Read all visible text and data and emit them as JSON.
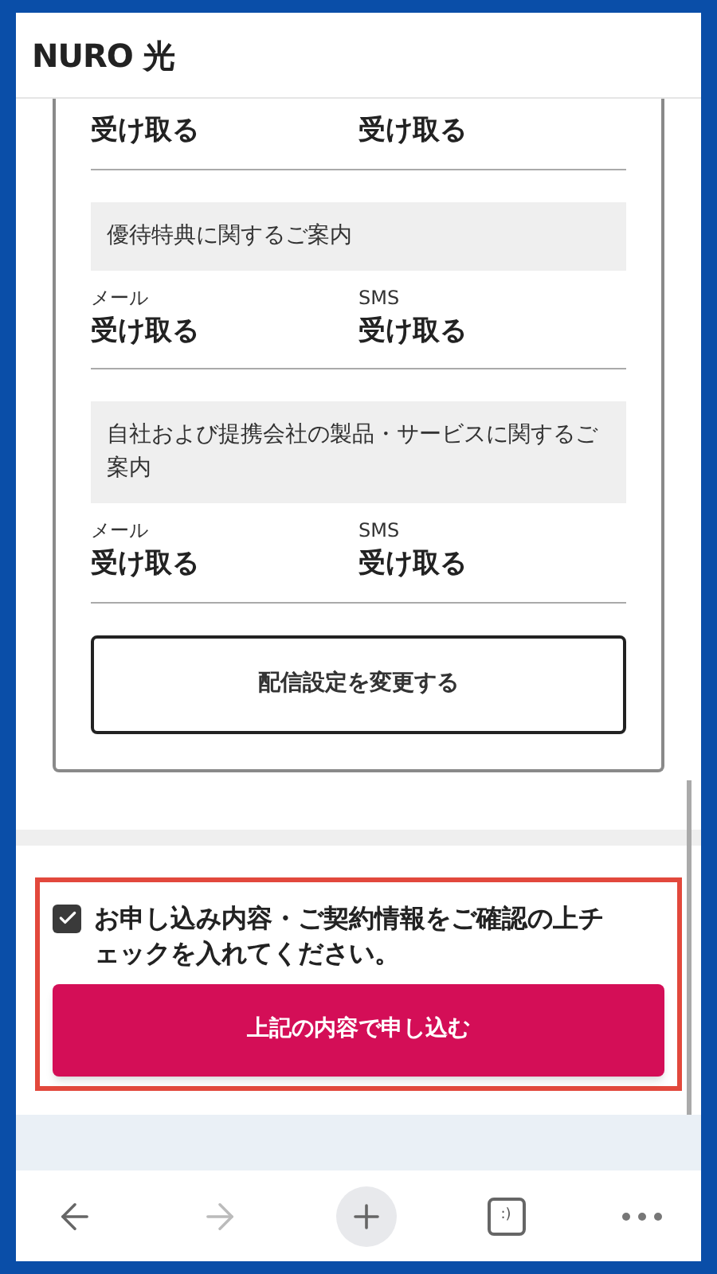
{
  "header": {
    "logo": "NURO 光"
  },
  "sections": [
    {
      "fields": [
        {
          "value": "受け取る"
        },
        {
          "value": "受け取る"
        }
      ]
    },
    {
      "title": "優待特典に関するご案内",
      "fields": [
        {
          "label": "メール",
          "value": "受け取る"
        },
        {
          "label": "SMS",
          "value": "受け取る"
        }
      ]
    },
    {
      "title": "自社および提携会社の製品・サービスに関するご案内",
      "fields": [
        {
          "label": "メール",
          "value": "受け取る"
        },
        {
          "label": "SMS",
          "value": "受け取る"
        }
      ]
    }
  ],
  "change_button": "配信設定を変更する",
  "consent": {
    "checked": true,
    "text": "お申し込み内容・ご契約情報をご確認の上チェックを入れてください。"
  },
  "submit_button": "上記の内容で申し込む",
  "toolbar": {
    "tabs_label": ":)",
    "forward_disabled": true
  }
}
